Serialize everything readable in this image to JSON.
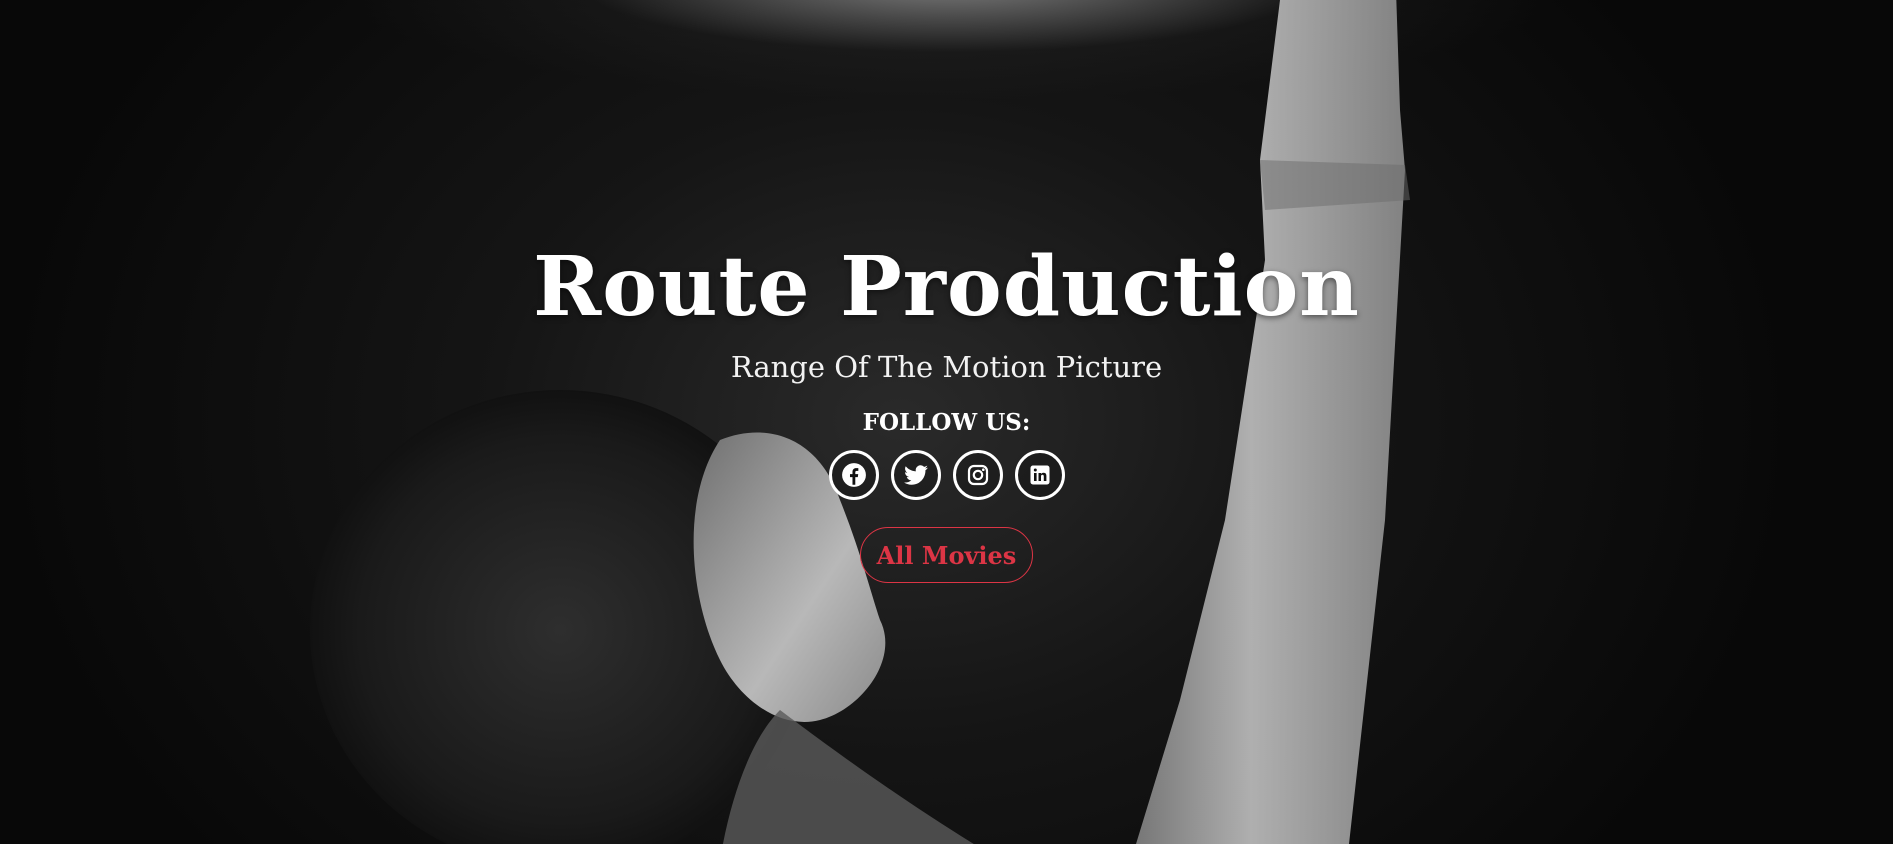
{
  "hero": {
    "title": "Route Production",
    "subtitle": "Range Of The Motion Picture",
    "follow_label": "FOLLOW US:",
    "socials": [
      {
        "name": "facebook",
        "icon": "facebook-icon"
      },
      {
        "name": "twitter",
        "icon": "twitter-icon"
      },
      {
        "name": "instagram",
        "icon": "instagram-icon"
      },
      {
        "name": "linkedin",
        "icon": "linkedin-icon"
      }
    ],
    "cta_label": "All Movies"
  },
  "colors": {
    "background": "#0a0a0a",
    "text": "#ffffff",
    "accent": "#dc3545"
  }
}
